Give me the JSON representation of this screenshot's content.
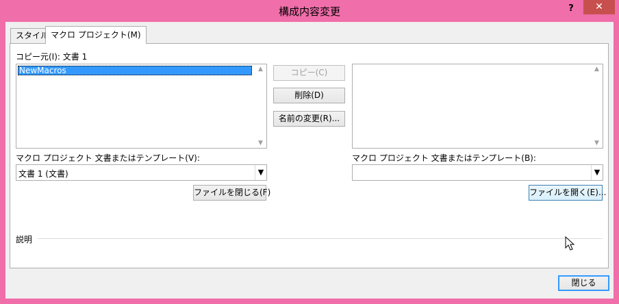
{
  "window": {
    "title": "構成内容変更",
    "help_label": "?",
    "close_label": "✕"
  },
  "tabs": [
    {
      "label": "スタイル"
    },
    {
      "label": "マクロ プロジェクト(M)"
    }
  ],
  "left": {
    "copy_from_label": "コピー元(I): 文書 1",
    "items": [
      "NewMacros"
    ],
    "combo_label": "マクロ プロジェクト 文書またはテンプレート(V):",
    "combo_value": "文書 1 (文書)",
    "close_file_button": "ファイルを閉じる(F)"
  },
  "middle": {
    "copy_button": "コピー(C)",
    "delete_button": "削除(D)",
    "rename_button": "名前の変更(R)..."
  },
  "right": {
    "combo_label": "マクロ プロジェクト 文書またはテンプレート(B):",
    "combo_value": "",
    "open_file_button": "ファイルを開く(E)..."
  },
  "description_label": "説明",
  "footer": {
    "close_button": "閉じる"
  },
  "colors": {
    "frame": "#f06eaa",
    "selection": "#3399ff",
    "close_red": "#c7504e"
  }
}
